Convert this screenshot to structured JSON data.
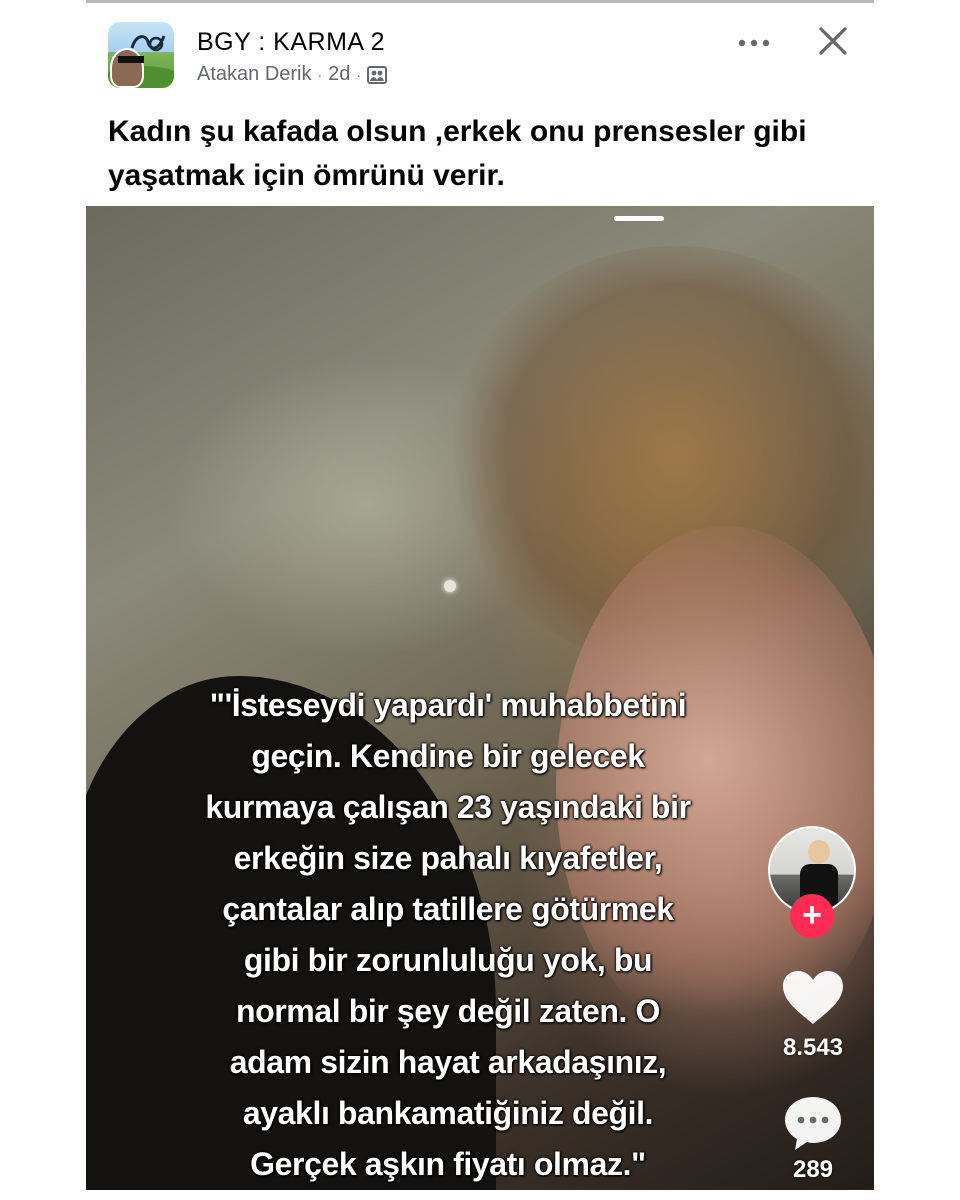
{
  "post": {
    "group_name": "BGY : KARMA 2",
    "author": "Atakan Derik",
    "separator": "·",
    "time_ago": "2d",
    "caption": "Kadın şu kafada olsun ,erkek onu prensesler gibi yaşatmak için ömrünü verir.",
    "icons": {
      "more": "more-horizontal-icon",
      "close": "close-icon",
      "audience": "group-audience-icon"
    }
  },
  "video": {
    "overlay_lines": [
      "\"'İsteseydi yapardı' muhabbetini",
      "geçin. Kendine bir gelecek",
      "kurmaya çalışan 23 yaşındaki bir",
      "erkeğin size pahalı kıyafetler,",
      "çantalar alıp tatillere götürmek",
      "gibi bir zorunluluğu yok, bu",
      "normal bir şey değil zaten. O",
      "adam sizin hayat arkadaşınız,",
      "ayaklı bankamatiğiniz değil.",
      "Gerçek aşkın fiyatı olmaz.\""
    ],
    "follow_symbol": "+",
    "likes": "8.543",
    "comments": "289",
    "colors": {
      "follow_accent": "#fe2c55"
    }
  }
}
